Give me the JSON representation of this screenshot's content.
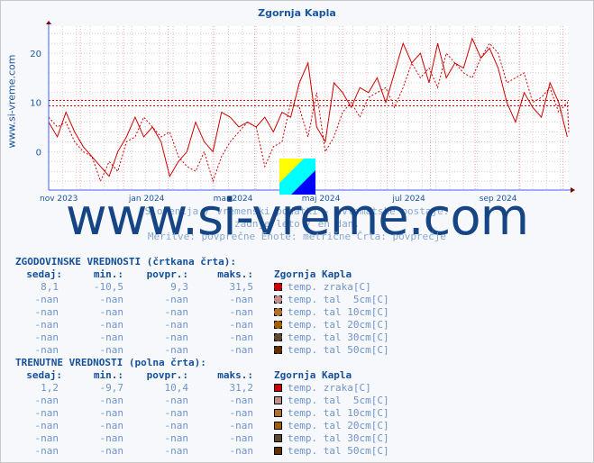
{
  "title": "Zgornja Kapla",
  "side_label": "www.si-vreme.com",
  "watermark": "www.si-vreme.com",
  "subtitles": [
    "Slovenija / vremenski podatki - avtomatske postaje.",
    "zadnje leto / en dan.",
    "Meritve: povprečne  Enote: metrične  Črta: povprečje"
  ],
  "chart_data": {
    "type": "line",
    "title": "Zgornja Kapla",
    "x_range": [
      "2023-10-10",
      "2024-10-05"
    ],
    "ylim": [
      -7.8,
      25.5
    ],
    "yticks": [
      0,
      10,
      20
    ],
    "xtick_labels": [
      {
        "date": "2023-11-01",
        "label": "nov 2023"
      },
      {
        "date": "2024-01-01",
        "label": "jan 2024"
      },
      {
        "date": "2024-03-01",
        "label": "mar 2024"
      },
      {
        "date": "2024-05-01",
        "label": "maj 2024"
      },
      {
        "date": "2024-07-01",
        "label": "jul 2024"
      },
      {
        "date": "2024-09-01",
        "label": "sep 2024"
      }
    ],
    "grid": true,
    "color": "#cc0000",
    "series": [
      {
        "style": "solid",
        "step_days": 6,
        "values": [
          6,
          3,
          8,
          4,
          1,
          -1,
          -3,
          -5,
          0,
          3,
          7,
          3,
          5,
          2,
          -5,
          -2,
          0,
          6,
          2,
          0,
          8,
          7,
          5,
          6,
          5,
          7,
          4,
          8,
          7,
          14,
          18,
          5,
          2,
          14,
          12,
          9,
          13,
          12,
          15,
          10,
          16,
          22,
          18,
          20,
          14,
          22,
          15,
          18,
          17,
          23,
          19,
          21,
          17,
          10,
          6,
          12,
          9,
          7,
          14,
          10,
          3
        ]
      },
      {
        "style": "dashed",
        "step_days": 6,
        "values": [
          7,
          5,
          6,
          2,
          0,
          -1,
          -6,
          -2,
          -4,
          2,
          3,
          7,
          5,
          3,
          4,
          -1,
          -3,
          -4,
          0,
          -6,
          -1,
          2,
          4,
          6,
          5,
          -3,
          1,
          2,
          10,
          9,
          3,
          12,
          0,
          3,
          8,
          10,
          7,
          11,
          12,
          13,
          9,
          13,
          18,
          15,
          17,
          13,
          20,
          18,
          16,
          15,
          19,
          22,
          20,
          14,
          15,
          16,
          10,
          11,
          13,
          8,
          10,
          4
        ]
      }
    ],
    "avg_lines": [
      {
        "label": "zgodovinsko povprečje",
        "value": 9.3
      },
      {
        "label": "trenutno povprečje",
        "value": 10.4
      }
    ]
  },
  "tables": [
    {
      "heading": "ZGODOVINSKE VREDNOSTI (črtkana črta):",
      "headers": [
        "sedaj:",
        "min.:",
        "povpr.:",
        "maks.:",
        "Zgornja Kapla"
      ],
      "dashed": true,
      "rows": [
        [
          "8,1",
          "-10,5",
          "9,3",
          "31,5",
          "temp. zraka[C]",
          "#cc0000"
        ],
        [
          "-nan",
          "-nan",
          "-nan",
          "-nan",
          "temp. tal  5cm[C]",
          "#c09090"
        ],
        [
          "-nan",
          "-nan",
          "-nan",
          "-nan",
          "temp. tal 10cm[C]",
          "#b07030"
        ],
        [
          "-nan",
          "-nan",
          "-nan",
          "-nan",
          "temp. tal 20cm[C]",
          "#a06000"
        ],
        [
          "-nan",
          "-nan",
          "-nan",
          "-nan",
          "temp. tal 30cm[C]",
          "#604830"
        ],
        [
          "-nan",
          "-nan",
          "-nan",
          "-nan",
          "temp. tal 50cm[C]",
          "#603000"
        ]
      ]
    },
    {
      "heading": "TRENUTNE VREDNOSTI (polna črta):",
      "headers": [
        "sedaj:",
        "min.:",
        "povpr.:",
        "maks.:",
        "Zgornja Kapla"
      ],
      "dashed": false,
      "rows": [
        [
          "1,2",
          "-9,7",
          "10,4",
          "31,2",
          "temp. zraka[C]",
          "#cc0000"
        ],
        [
          "-nan",
          "-nan",
          "-nan",
          "-nan",
          "temp. tal  5cm[C]",
          "#c09090"
        ],
        [
          "-nan",
          "-nan",
          "-nan",
          "-nan",
          "temp. tal 10cm[C]",
          "#b07030"
        ],
        [
          "-nan",
          "-nan",
          "-nan",
          "-nan",
          "temp. tal 20cm[C]",
          "#a06000"
        ],
        [
          "-nan",
          "-nan",
          "-nan",
          "-nan",
          "temp. tal 30cm[C]",
          "#604830"
        ],
        [
          "-nan",
          "-nan",
          "-nan",
          "-nan",
          "temp. tal 50cm[C]",
          "#603000"
        ]
      ]
    }
  ]
}
